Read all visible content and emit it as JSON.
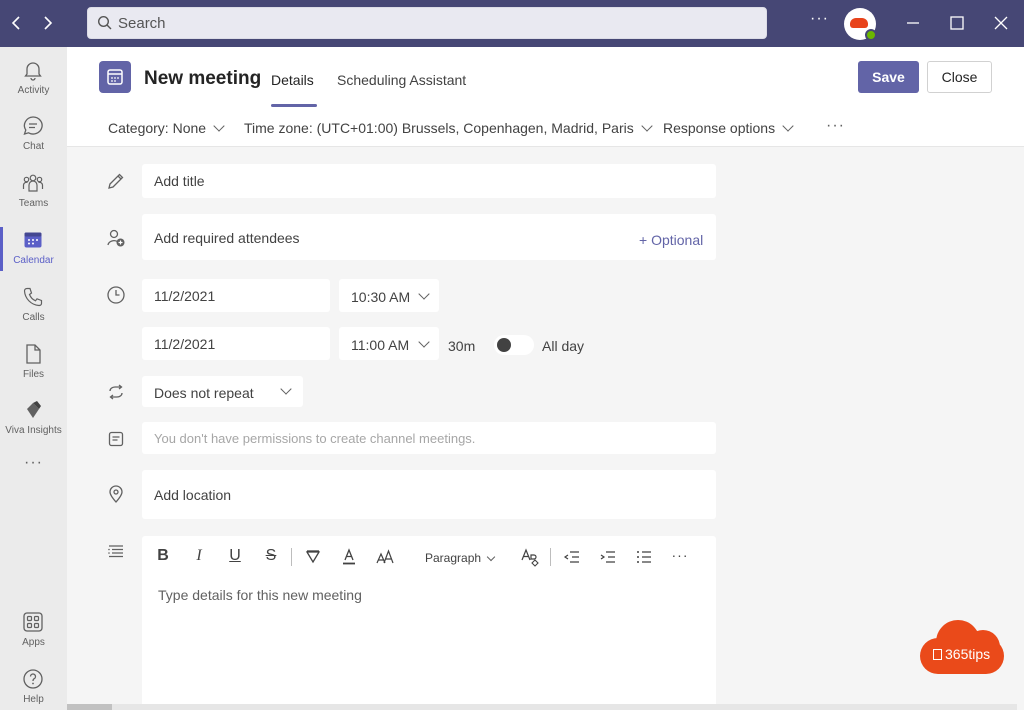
{
  "titlebar": {
    "back_icon": "chevron-left-icon",
    "forward_icon": "chevron-right-icon",
    "search_placeholder": "Search",
    "more_label": "···",
    "brand_color": "#464775"
  },
  "rail": {
    "items": [
      {
        "label": "Activity",
        "icon": "bell-icon"
      },
      {
        "label": "Chat",
        "icon": "chat-icon"
      },
      {
        "label": "Teams",
        "icon": "teams-icon"
      },
      {
        "label": "Calendar",
        "icon": "calendar-icon",
        "active": true
      },
      {
        "label": "Calls",
        "icon": "phone-icon"
      },
      {
        "label": "Files",
        "icon": "file-icon"
      },
      {
        "label": "Viva Insights",
        "icon": "viva-insights-icon"
      }
    ],
    "more_label": "···",
    "bottom_items": [
      {
        "label": "Apps",
        "icon": "apps-icon"
      },
      {
        "label": "Help",
        "icon": "help-icon"
      }
    ]
  },
  "header": {
    "title": "New meeting",
    "tabs": [
      {
        "label": "Details",
        "active": true
      },
      {
        "label": "Scheduling Assistant",
        "active": false
      }
    ],
    "save_label": "Save",
    "close_label": "Close",
    "accent_color": "#6264a7"
  },
  "options_bar": {
    "category": "Category: None",
    "timezone": "Time zone: (UTC+01:00) Brussels, Copenhagen, Madrid, Paris",
    "response": "Response options",
    "more_label": "···"
  },
  "form": {
    "title_placeholder": "Add title",
    "attendees_placeholder": "Add required attendees",
    "optional_link": "+ Optional",
    "start_date": "11/2/2021",
    "start_time": "10:30 AM",
    "end_date": "11/2/2021",
    "end_time": "11:00 AM",
    "duration": "30m",
    "all_day_label": "All day",
    "all_day_on": false,
    "repeat": "Does not repeat",
    "channel_placeholder": "You don't have permissions to create channel meetings.",
    "location_placeholder": "Add location",
    "details_placeholder": "Type details for this new meeting"
  },
  "editor_toolbar": {
    "bold": "B",
    "italic": "I",
    "underline": "U",
    "strike": "S",
    "paragraph_label": "Paragraph",
    "more_label": "···"
  },
  "watermark": {
    "text": "365tips"
  }
}
